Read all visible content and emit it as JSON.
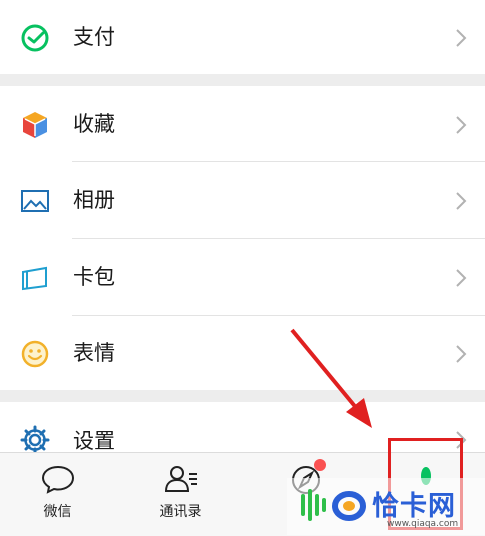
{
  "menu": {
    "payment": {
      "label": "支付",
      "icon": "payment-icon"
    },
    "favorites": {
      "label": "收藏",
      "icon": "cube-icon"
    },
    "album": {
      "label": "相册",
      "icon": "image-icon"
    },
    "cards": {
      "label": "卡包",
      "icon": "card-icon"
    },
    "stickers": {
      "label": "表情",
      "icon": "smile-icon"
    },
    "settings": {
      "label": "设置",
      "icon": "gear-icon"
    }
  },
  "tabs": {
    "chats": {
      "label": "微信",
      "icon": "chat-bubble-icon"
    },
    "contacts": {
      "label": "通讯录",
      "icon": "contacts-icon"
    },
    "discover": {
      "label": "",
      "icon": "compass-icon"
    },
    "me": {
      "label": "",
      "icon": "person-icon"
    }
  },
  "watermark": {
    "title": "恰卡网",
    "url": "www.qiaqa.com"
  },
  "colors": {
    "wechat_green": "#07c160",
    "annotation_red": "#e02020",
    "watermark_blue": "#2a5fd6",
    "section_gap": "#ededed"
  }
}
